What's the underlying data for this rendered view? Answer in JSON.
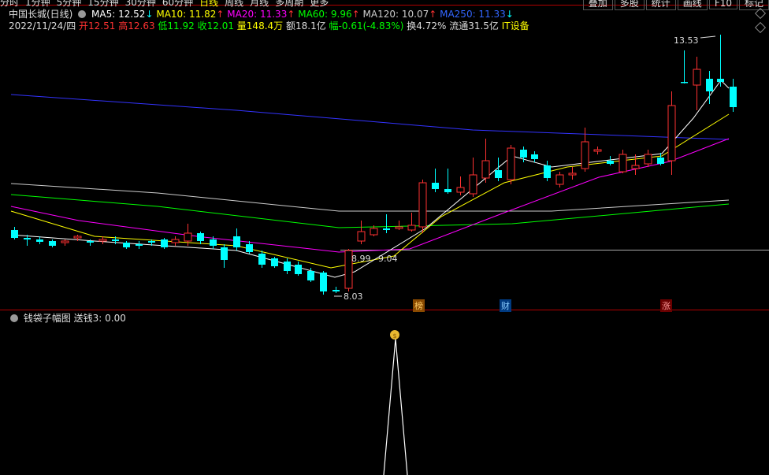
{
  "tabs": [
    "分时",
    "1分钟",
    "5分钟",
    "15分钟",
    "30分钟",
    "60分钟",
    "日线",
    "周线",
    "月线",
    "多周期",
    "更多"
  ],
  "tabs_right": [
    "叠加",
    "多股",
    "统计",
    "画线",
    "F10",
    "标记"
  ],
  "line1": {
    "title": "中国长城(日线)",
    "ma5": "MA5: 12.52",
    "ma10": "MA10: 11.82",
    "ma20": "MA20: 11.33",
    "ma60": "MA60: 9.96",
    "ma120": "MA120: 10.07",
    "ma250": "MA250: 11.33"
  },
  "line2": {
    "date": "2022/11/24/四",
    "open": "开12.51",
    "high": "高12.63",
    "low": "低11.92",
    "close": "收12.01",
    "vol": "量148.4万",
    "amt": "额18.1亿",
    "chg": "幅-0.61(-4.83%)",
    "turn": "换4.72%",
    "float": "流通31.5亿",
    "sector": "IT设备"
  },
  "annotations": {
    "high_label": "13.53",
    "low_label": "8.03",
    "mid_label1": "8.99",
    "mid_label2": "9.04",
    "tag1": "榜",
    "tag2": "财",
    "tag3": "涨"
  },
  "indicator": {
    "title": "钱袋子幅图",
    "value": "送钱3: 0.00"
  },
  "colors": {
    "up": "#ff3232",
    "down": "#00ffff",
    "ma5": "#ffffff",
    "ma10": "#ffff00",
    "ma20": "#ff00ff",
    "ma60": "#00ff00",
    "ma120": "#cccccc",
    "ma250": "#3333ff"
  }
}
